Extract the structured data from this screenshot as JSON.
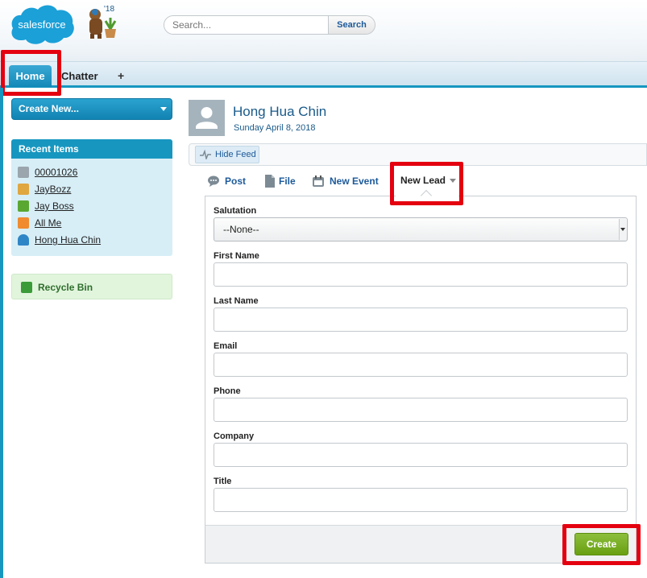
{
  "header": {
    "logo_text": "salesforce",
    "mascot_year": "'18",
    "search_placeholder": "Search...",
    "search_button": "Search"
  },
  "tabs": [
    {
      "label": "Home",
      "active": true
    },
    {
      "label": "Chatter",
      "active": false
    },
    {
      "label": "+",
      "icon": "plus-icon"
    }
  ],
  "sidebar": {
    "create_new": "Create New...",
    "recent_title": "Recent Items",
    "recent_items": [
      {
        "label": "00001026",
        "icon": "case-icon",
        "color": "#9aa5ad"
      },
      {
        "label": "JayBozz",
        "icon": "contact-icon",
        "color": "#e0a640"
      },
      {
        "label": "Jay Boss",
        "icon": "lead-icon",
        "color": "#5aa832"
      },
      {
        "label": "All Me",
        "icon": "account-icon",
        "color": "#f08b2f"
      },
      {
        "label": "Hong Hua Chin",
        "icon": "user-icon",
        "color": "#2f86c6"
      }
    ],
    "recycle_bin": "Recycle Bin"
  },
  "profile": {
    "name": "Hong Hua Chin",
    "date": "Sunday April 8, 2018"
  },
  "feed": {
    "hide_feed": "Hide Feed"
  },
  "publisher": {
    "actions": [
      {
        "label": "Post",
        "icon": "post-icon"
      },
      {
        "label": "File",
        "icon": "file-icon"
      },
      {
        "label": "New Event",
        "icon": "calendar-icon"
      }
    ],
    "active_action": "New Lead"
  },
  "form": {
    "salutation_label": "Salutation",
    "salutation_value": "--None--",
    "first_name_label": "First Name",
    "last_name_label": "Last Name",
    "email_label": "Email",
    "phone_label": "Phone",
    "company_label": "Company",
    "title_label": "Title",
    "first_name": "",
    "last_name": "",
    "email": "",
    "phone": "",
    "company": "",
    "title": "",
    "submit": "Create"
  },
  "colors": {
    "accent": "#1797c0",
    "highlight": "#e4000f",
    "create_button": "#7ab12a"
  }
}
